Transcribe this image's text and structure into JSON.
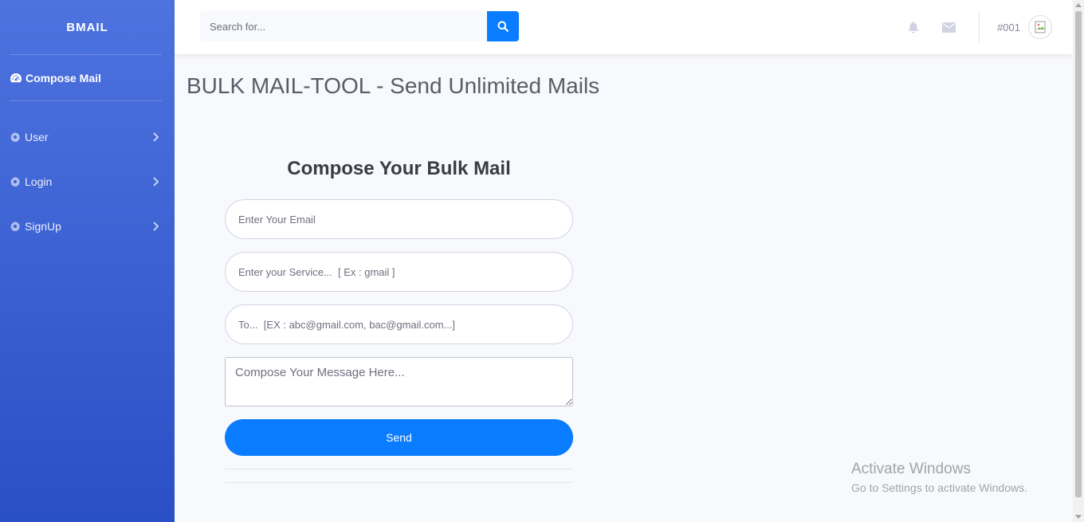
{
  "sidebar": {
    "brand": "BMAIL",
    "active_item": {
      "label": "Compose Mail",
      "icon": "dashboard-icon"
    },
    "items": [
      {
        "label": "User",
        "icon": "cog-icon"
      },
      {
        "label": "Login",
        "icon": "cog-icon"
      },
      {
        "label": "SignUp",
        "icon": "cog-icon"
      }
    ]
  },
  "topbar": {
    "search_placeholder": "Search for...",
    "user_id": "#001"
  },
  "main": {
    "page_title": "BULK MAIL-TOOL - Send Unlimited Mails",
    "form_title": "Compose Your Bulk Mail",
    "email_placeholder": "Enter Your Email",
    "service_placeholder": "Enter your Service...  [ Ex : gmail ]",
    "to_placeholder": "To...  [EX : abc@gmail.com, bac@gmail.com...]",
    "message_placeholder": "Compose Your Message Here...",
    "send_label": "Send"
  },
  "watermark": {
    "line1": "Activate Windows",
    "line2": "Go to Settings to activate Windows."
  },
  "colors": {
    "sidebar_top": "#4e73df",
    "sidebar_bottom": "#2a4fc6",
    "primary": "#0a7cff"
  }
}
